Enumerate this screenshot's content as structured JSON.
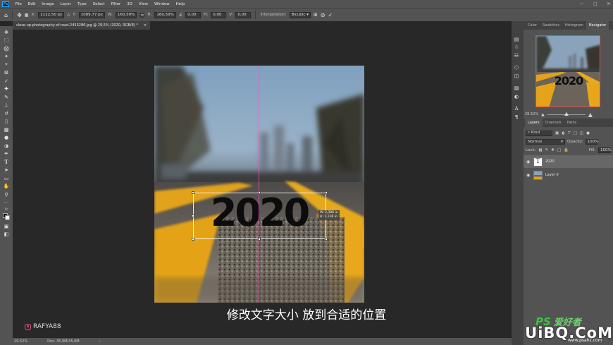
{
  "app": {
    "logo_text": "Ps",
    "window_controls": [
      "—",
      "□",
      "✕"
    ]
  },
  "menu": [
    "File",
    "Edit",
    "Image",
    "Layer",
    "Type",
    "Select",
    "Filter",
    "3D",
    "View",
    "Window",
    "Help"
  ],
  "options": {
    "x_label": "X:",
    "x_value": "1112,50 px",
    "y_label": "Y:",
    "y_value": "1089,77 px",
    "w_label": "W:",
    "w_value": "160,59%",
    "link_icon": "chain-link-icon",
    "h_label": "H:",
    "h_value": "160,59%",
    "angle_value": "0,00",
    "hskew_label": "H:",
    "hskew_value": "0,00",
    "vskew_label": "V:",
    "vskew_value": "0,00",
    "interp_label": "Interpolation:",
    "interp_value": "Bicubic"
  },
  "doc_tab": {
    "title": "close-up-photography-of-road-2453286.jpg @ 29,5% (2020, RGB/8) *",
    "close": "×"
  },
  "canvas": {
    "text_layer": "2020",
    "transform_info": {
      "w": "W: 2,386 in",
      "h": "H: 1,128 in"
    }
  },
  "subtitle": "修改文字大小 放到合适的位置",
  "instagram_handle": "RAFYA88",
  "status": {
    "zoom": "29.52%",
    "doc": "Doc: 35,9M/35,6M",
    "arrow": "›"
  },
  "panels": {
    "top_tabs": [
      "Color",
      "Swatches",
      "Histogram",
      "Navigator"
    ],
    "active_top_tab": "Navigator",
    "nav_thumb_text": "2020",
    "nav_zoom": "29.52%",
    "layer_tabs": [
      "Layers",
      "Channels",
      "Paths"
    ],
    "filter_label": "⌕ Kind",
    "blend_mode": "Normal",
    "opacity_label": "Opacity:",
    "opacity_value": "100%",
    "lock_label": "Lock:",
    "fill_label": "Fill:",
    "fill_value": "100%",
    "layers": [
      {
        "name": "2020",
        "thumb": "T",
        "selected": true
      },
      {
        "name": "Layer 0",
        "thumb": "",
        "selected": false
      }
    ]
  },
  "watermark": {
    "ps_text": "PS",
    "chinese": "爱好者",
    "logo": "UiBQ.CoM",
    "site": "www.psahz.com"
  },
  "colors": {
    "accent_blue": "#31a8ff",
    "nav_border": "#e24b4b",
    "guide": "#ff4fd6",
    "road_yellow": "#e1a21c"
  }
}
